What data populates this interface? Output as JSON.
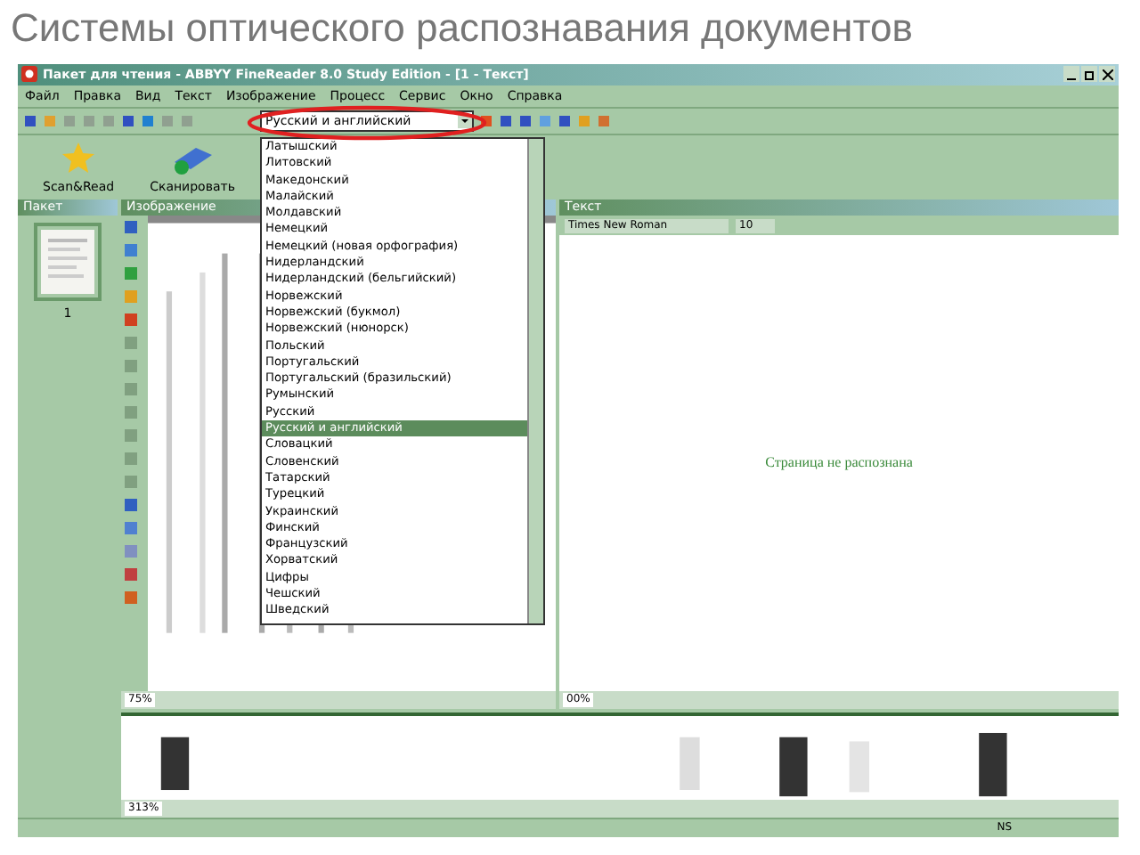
{
  "slide_title": "Системы оптического распознавания документов",
  "window": {
    "title": "Пакет для чтения - ABBYY FineReader 8.0 Study Edition - [1 - Текст]"
  },
  "menu": [
    "Файл",
    "Правка",
    "Вид",
    "Текст",
    "Изображение",
    "Процесс",
    "Сервис",
    "Окно",
    "Справка"
  ],
  "language_combo": {
    "value": "Русский и английский",
    "highlighted": true
  },
  "language_list": [
    {
      "label": "Латышский",
      "selected": false
    },
    {
      "label": "Литовский",
      "selected": false
    },
    {
      "label": "Македонский",
      "selected": false
    },
    {
      "label": "Малайский",
      "selected": false
    },
    {
      "label": "Молдавский",
      "selected": false
    },
    {
      "label": "Немецкий",
      "selected": false
    },
    {
      "label": "Немецкий (новая орфография)",
      "selected": false
    },
    {
      "label": "Нидерландский",
      "selected": false
    },
    {
      "label": "Нидерландский (бельгийский)",
      "selected": false
    },
    {
      "label": "Норвежский",
      "selected": false
    },
    {
      "label": "Норвежский (букмол)",
      "selected": false
    },
    {
      "label": "Норвежский (нюнорск)",
      "selected": false
    },
    {
      "label": "Польский",
      "selected": false
    },
    {
      "label": "Португальский",
      "selected": false
    },
    {
      "label": "Португальский (бразильский)",
      "selected": false
    },
    {
      "label": "Румынский",
      "selected": false
    },
    {
      "label": "Русский",
      "selected": false
    },
    {
      "label": "Русский и английский",
      "selected": true
    },
    {
      "label": "Словацкий",
      "selected": false
    },
    {
      "label": "Словенский",
      "selected": false
    },
    {
      "label": "Татарский",
      "selected": false
    },
    {
      "label": "Турецкий",
      "selected": false
    },
    {
      "label": "Украинский",
      "selected": false
    },
    {
      "label": "Финский",
      "selected": false
    },
    {
      "label": "Французский",
      "selected": false
    },
    {
      "label": "Хорватский",
      "selected": false
    },
    {
      "label": "Цифры",
      "selected": false
    },
    {
      "label": "Чешский",
      "selected": false
    },
    {
      "label": "Шведский",
      "selected": false
    }
  ],
  "big_buttons": [
    {
      "label": "Scan&Read",
      "kind": "wizard"
    },
    {
      "label": "Сканировать",
      "kind": "scanner"
    }
  ],
  "batch_pane": {
    "title": "Пакет",
    "pages": [
      {
        "number": "1"
      }
    ]
  },
  "image_pane": {
    "title": "Изображение",
    "zoom": "75%"
  },
  "text_pane": {
    "title": "Текст",
    "font": "Times New Roman",
    "size": "10",
    "message": "Страница не распознана",
    "zoom": "00%"
  },
  "zoom_pane": {
    "zoom": "313%"
  },
  "status_bar": [
    "NS"
  ]
}
